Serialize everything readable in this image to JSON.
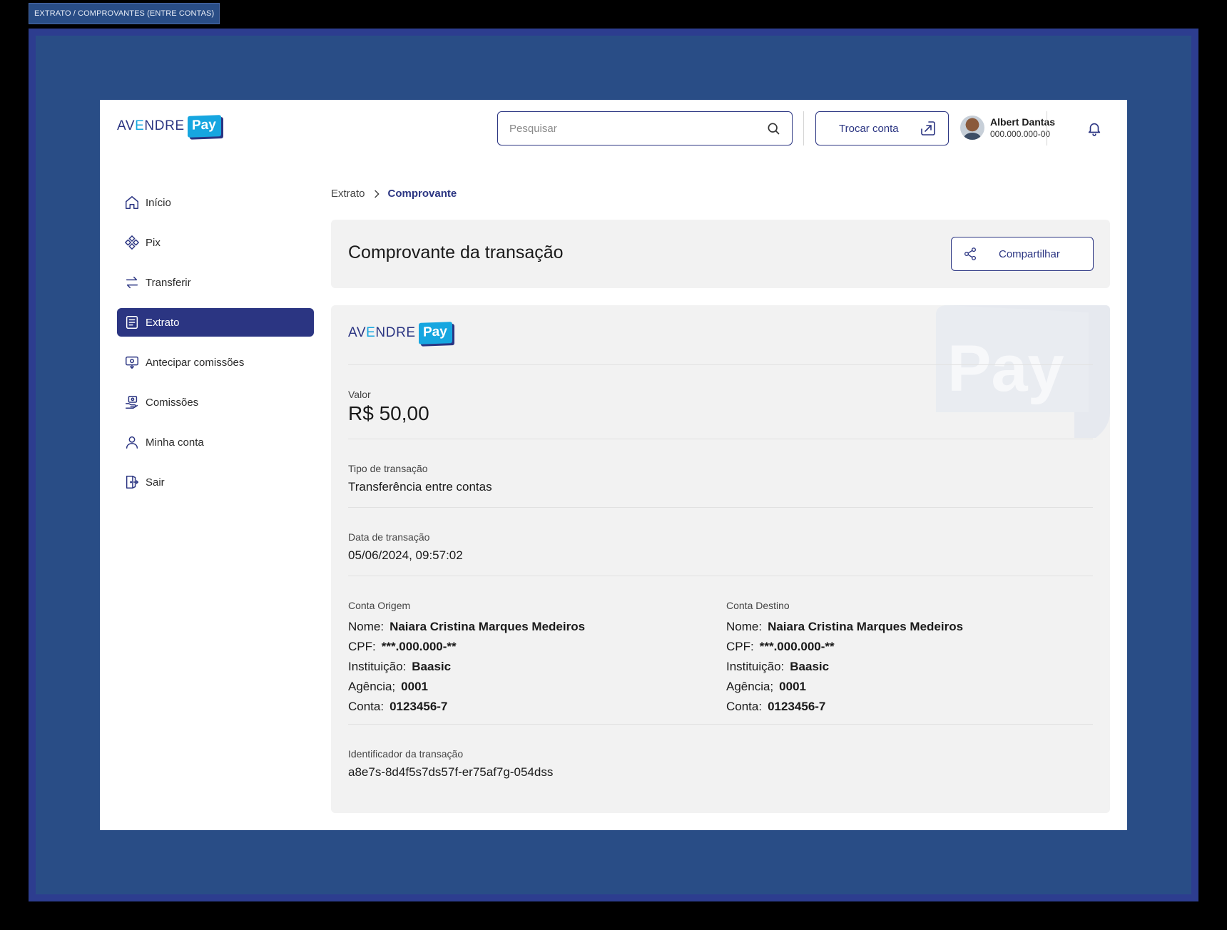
{
  "frame_label": "EXTRATO / COMPROVANTES (ENTRE CONTAS)",
  "brand": {
    "word_pre": "AV",
    "word_accent": "E",
    "word_post": "NDRE",
    "pay": "Pay",
    "primary": "#2b3582",
    "accent": "#16a6e0"
  },
  "header": {
    "search_placeholder": "Pesquisar",
    "switch_account": "Trocar conta",
    "user_name": "Albert Dantas",
    "user_document": "000.000.000-00"
  },
  "sidebar": {
    "items": [
      {
        "label": "Início",
        "icon": "home-icon"
      },
      {
        "label": "Pix",
        "icon": "pix-icon"
      },
      {
        "label": "Transferir",
        "icon": "transfer-icon"
      },
      {
        "label": "Extrato",
        "icon": "statement-icon",
        "active": true
      },
      {
        "label": "Antecipar comissões",
        "icon": "advance-icon"
      },
      {
        "label": "Comissões",
        "icon": "commission-icon"
      },
      {
        "label": "Minha conta",
        "icon": "user-icon"
      },
      {
        "label": "Sair",
        "icon": "logout-icon"
      }
    ]
  },
  "breadcrumb": {
    "parent": "Extrato",
    "current": "Comprovante"
  },
  "page": {
    "title": "Comprovante da transação",
    "share_label": "Compartilhar"
  },
  "receipt": {
    "amount_label": "Valor",
    "amount": "R$ 50,00",
    "type_label": "Tipo de transação",
    "type": "Transferência entre contas",
    "date_label": "Data de transação",
    "date": "05/06/2024, 09:57:02",
    "origin": {
      "title": "Conta Origem",
      "name_key": "Nome:",
      "name": "Naiara Cristina Marques Medeiros",
      "cpf_key": "CPF:",
      "cpf": "***.000.000-**",
      "inst_key": "Instituição:",
      "inst": "Baasic",
      "agency_key": "Agência;",
      "agency": "0001",
      "account_key": "Conta:",
      "account": "0123456-7"
    },
    "destination": {
      "title": "Conta Destino",
      "name_key": "Nome:",
      "name": "Naiara Cristina Marques Medeiros",
      "cpf_key": "CPF:",
      "cpf": "***.000.000-**",
      "inst_key": "Instituição:",
      "inst": "Baasic",
      "agency_key": "Agência;",
      "agency": "0001",
      "account_key": "Conta:",
      "account": "0123456-7"
    },
    "id_label": "Identificador da transação",
    "id": "a8e7s-8d4f5s7ds57f-er75af7g-054dss"
  }
}
